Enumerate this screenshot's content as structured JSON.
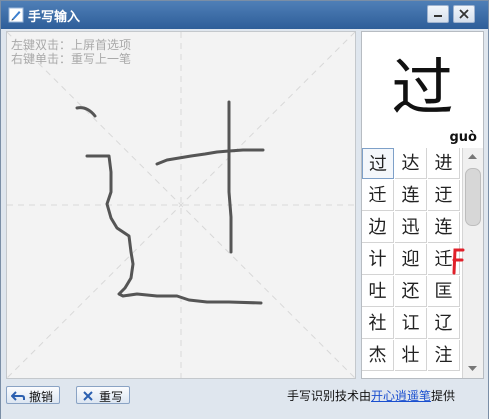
{
  "window": {
    "title": "手写输入",
    "title_icon": "pen-icon",
    "min_label": "–",
    "close_label": "×"
  },
  "canvas": {
    "hint_line1": "左键双击：上屏首选项",
    "hint_line2": "右键单击：重写上一笔"
  },
  "preview": {
    "char": "过",
    "pinyin": "guò"
  },
  "candidates": [
    "过",
    "达",
    "进",
    "迁",
    "连",
    "迂",
    "边",
    "迅",
    "连",
    "计",
    "迎",
    "迁",
    "吐",
    "还",
    "匡",
    "社",
    "讧",
    "辽",
    "杰",
    "壮",
    "注"
  ],
  "buttons": {
    "undo": "撤销",
    "rewrite": "重写"
  },
  "footer": {
    "prefix": "手写识别技术由",
    "link": "开心逍遥笔",
    "suffix": "提供"
  },
  "colors": {
    "accent": "#2e5e99",
    "stroke": "#555555",
    "link": "#1a4fcf",
    "red_mark": "#e0202a"
  }
}
